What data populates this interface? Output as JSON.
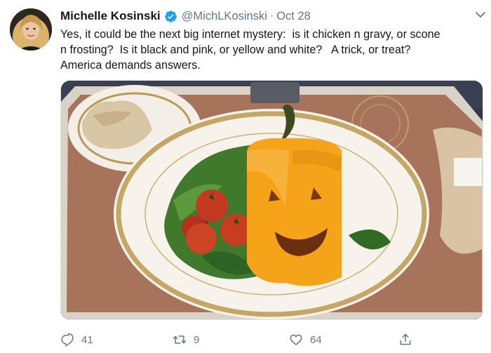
{
  "tweet": {
    "author_name": "Michelle Kosinski",
    "handle": "@MichLKosinski",
    "separator": "·",
    "date": "Oct 28",
    "text_lines": [
      "Yes, it could be the next big internet mystery:  is it chicken n gravy, or scone",
      "n frosting?  Is it black and pink, or yellow and white?   A trick, or treat?",
      "America demands answers."
    ]
  },
  "actions": {
    "reply_count": "41",
    "retweet_count": "9",
    "like_count": "64"
  },
  "colors": {
    "verified_blue": "#1da1f2",
    "muted_text": "#657786"
  },
  "icons": {
    "verified": "verified-badge-icon",
    "more": "chevron-down-icon",
    "reply": "reply-icon",
    "retweet": "retweet-icon",
    "like": "heart-icon",
    "share": "share-icon"
  }
}
